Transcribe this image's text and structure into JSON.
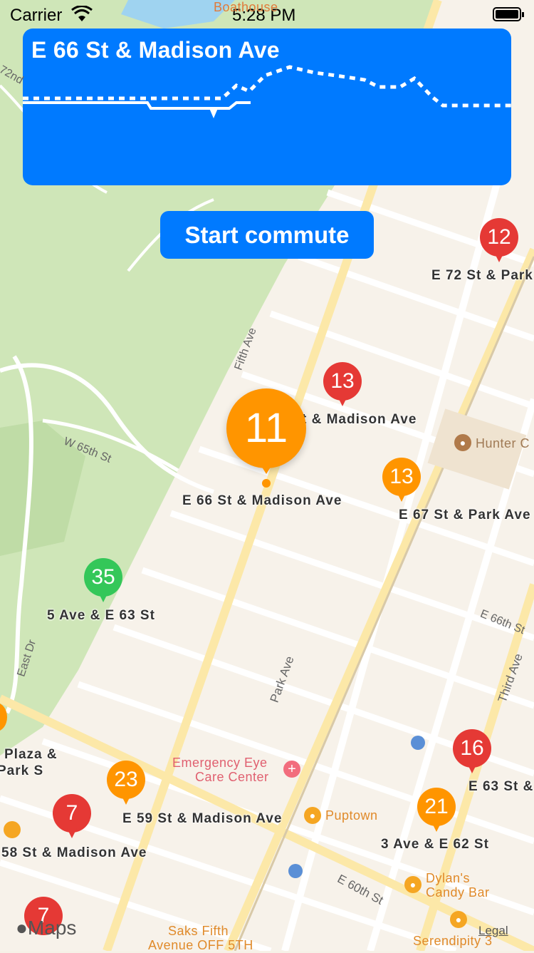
{
  "status_bar": {
    "carrier": "Carrier",
    "time": "5:28 PM"
  },
  "route_card": {
    "title": "E 66 St & Madison Ave"
  },
  "start_button": {
    "label": "Start commute"
  },
  "pins": [
    {
      "count": "12",
      "color": "#e53935",
      "label": "E 72 St & Park"
    },
    {
      "count": "13",
      "color": "#e53935",
      "label": "t & Madison Ave"
    },
    {
      "count": "11",
      "color": "#ff9500",
      "label": "E 66 St & Madison Ave"
    },
    {
      "count": "13",
      "color": "#ff9500",
      "label": "E 67 St & Park Ave"
    },
    {
      "count": "35",
      "color": "#34c759",
      "label": "5 Ave & E 63 St"
    },
    {
      "count": "16",
      "color": "#e53935",
      "label": "E 63 St &"
    },
    {
      "count": "23",
      "color": "#ff9500",
      "label": "E 59 St & Madison Ave"
    },
    {
      "count": "7",
      "color": "#e53935",
      "label": "58 St & Madison Ave"
    },
    {
      "count": "21",
      "color": "#ff9500",
      "label": "3 Ave & E 62 St"
    },
    {
      "count": "7",
      "color": "#e53935",
      "label": ""
    }
  ],
  "partial_labels": {
    "plaza_1": "Plaza &",
    "plaza_2": "Park S"
  },
  "pois": {
    "boathouse": "Boathouse",
    "hunter": "Hunter C",
    "emergency_1": "Emergency Eye",
    "emergency_2": "Care Center",
    "puptown": "Puptown",
    "dylans_1": "Dylan's",
    "dylans_2": "Candy Bar",
    "saks_1": "Saks Fifth",
    "saks_2": "Avenue OFF 5TH",
    "serendipity": "Serendipity 3"
  },
  "streets": {
    "fifth_ave": "Fifth Ave",
    "w65": "W 65th St",
    "east_dr": "East Dr",
    "park_ave": "Park Ave",
    "e66": "E 66th St",
    "third_ave": "Third Ave",
    "e60": "E 60th St",
    "w72nd": "72nd"
  },
  "footer": {
    "maps": "Maps",
    "legal": "Legal"
  },
  "colors": {
    "accent": "#007aff",
    "red_pin": "#e53935",
    "orange_pin": "#ff9500",
    "green_pin": "#34c759"
  }
}
